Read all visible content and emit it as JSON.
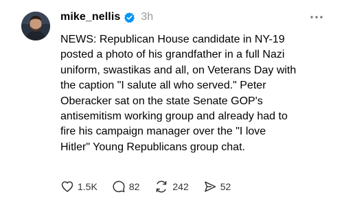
{
  "post": {
    "username": "mike_nellis",
    "timestamp": "3h",
    "body": "NEWS: Republican House candidate in NY-19\nposted a photo of his grandfather in a full Nazi\nuniform, swastikas and all, on Veterans Day with\nthe caption \"I salute all who served.\" Peter\nOberacker sat on the state Senate GOP's\nantisemitism working group and already had to\nfire his campaign manager over the \"I love\nHitler\" Young Republicans group chat.",
    "verified_color": "#0095f6",
    "actions": {
      "likes": "1.5K",
      "replies": "82",
      "reposts": "242",
      "shares": "52"
    },
    "icons": {
      "like": "heart-icon",
      "reply": "speech-bubble-icon",
      "repost": "repost-arrows-icon",
      "share": "send-icon",
      "more": "more-dots-icon",
      "verified": "verified-badge-icon"
    }
  }
}
